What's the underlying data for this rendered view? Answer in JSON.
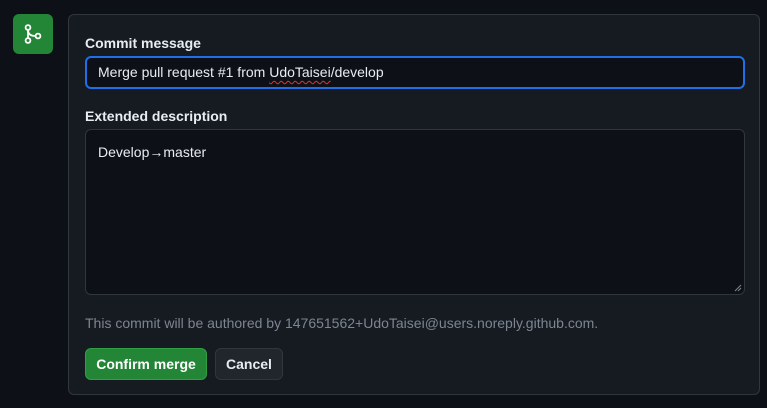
{
  "merge_icon": {
    "icon": "git-merge-icon",
    "color": "#238636"
  },
  "form": {
    "commit_message_label": "Commit message",
    "commit_message_prefix": "Merge pull request #1 from ",
    "commit_message_misspelled": "UdoTaisei",
    "commit_message_suffix": "/develop",
    "extended_description_label": "Extended description",
    "extended_description_value": "Develop→master",
    "author_note": "This commit will be authored by 147651562+UdoTaisei@users.noreply.github.com."
  },
  "buttons": {
    "confirm_label": "Confirm merge",
    "cancel_label": "Cancel"
  },
  "colors": {
    "background": "#0d1117",
    "panel": "#161b22",
    "focus_border": "#1f6feb",
    "confirm_green": "#238636",
    "muted_text": "#7d8590"
  }
}
